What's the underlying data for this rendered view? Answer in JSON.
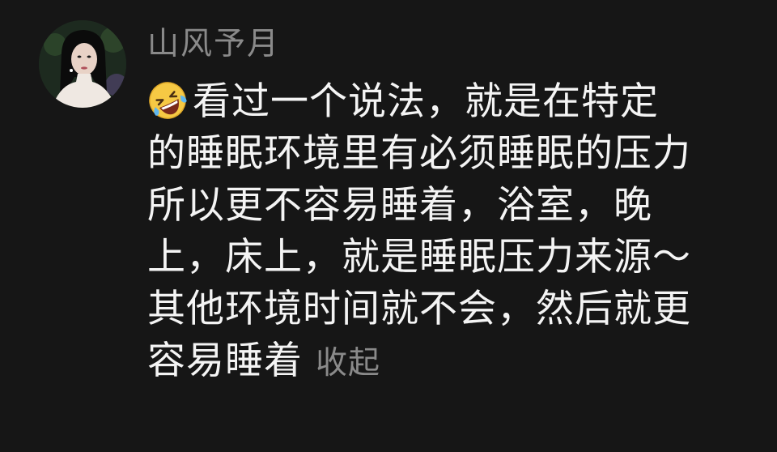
{
  "comment": {
    "username": "山风予月",
    "emoji": "rolling-on-floor-laughing-emoji",
    "lines": [
      "看过一个说法，就是在特定",
      "的睡眠环境里有必须睡眠的压力",
      "所以更不容易睡着，浴室，晚",
      "上，床上，就是睡眠压力来源～",
      "其他环境时间就不会，然后就更",
      "容易睡着"
    ],
    "collapse_label": "收起"
  },
  "colors": {
    "background": "#161616",
    "text": "#f4f4f4",
    "secondary": "#8a8a8a"
  }
}
